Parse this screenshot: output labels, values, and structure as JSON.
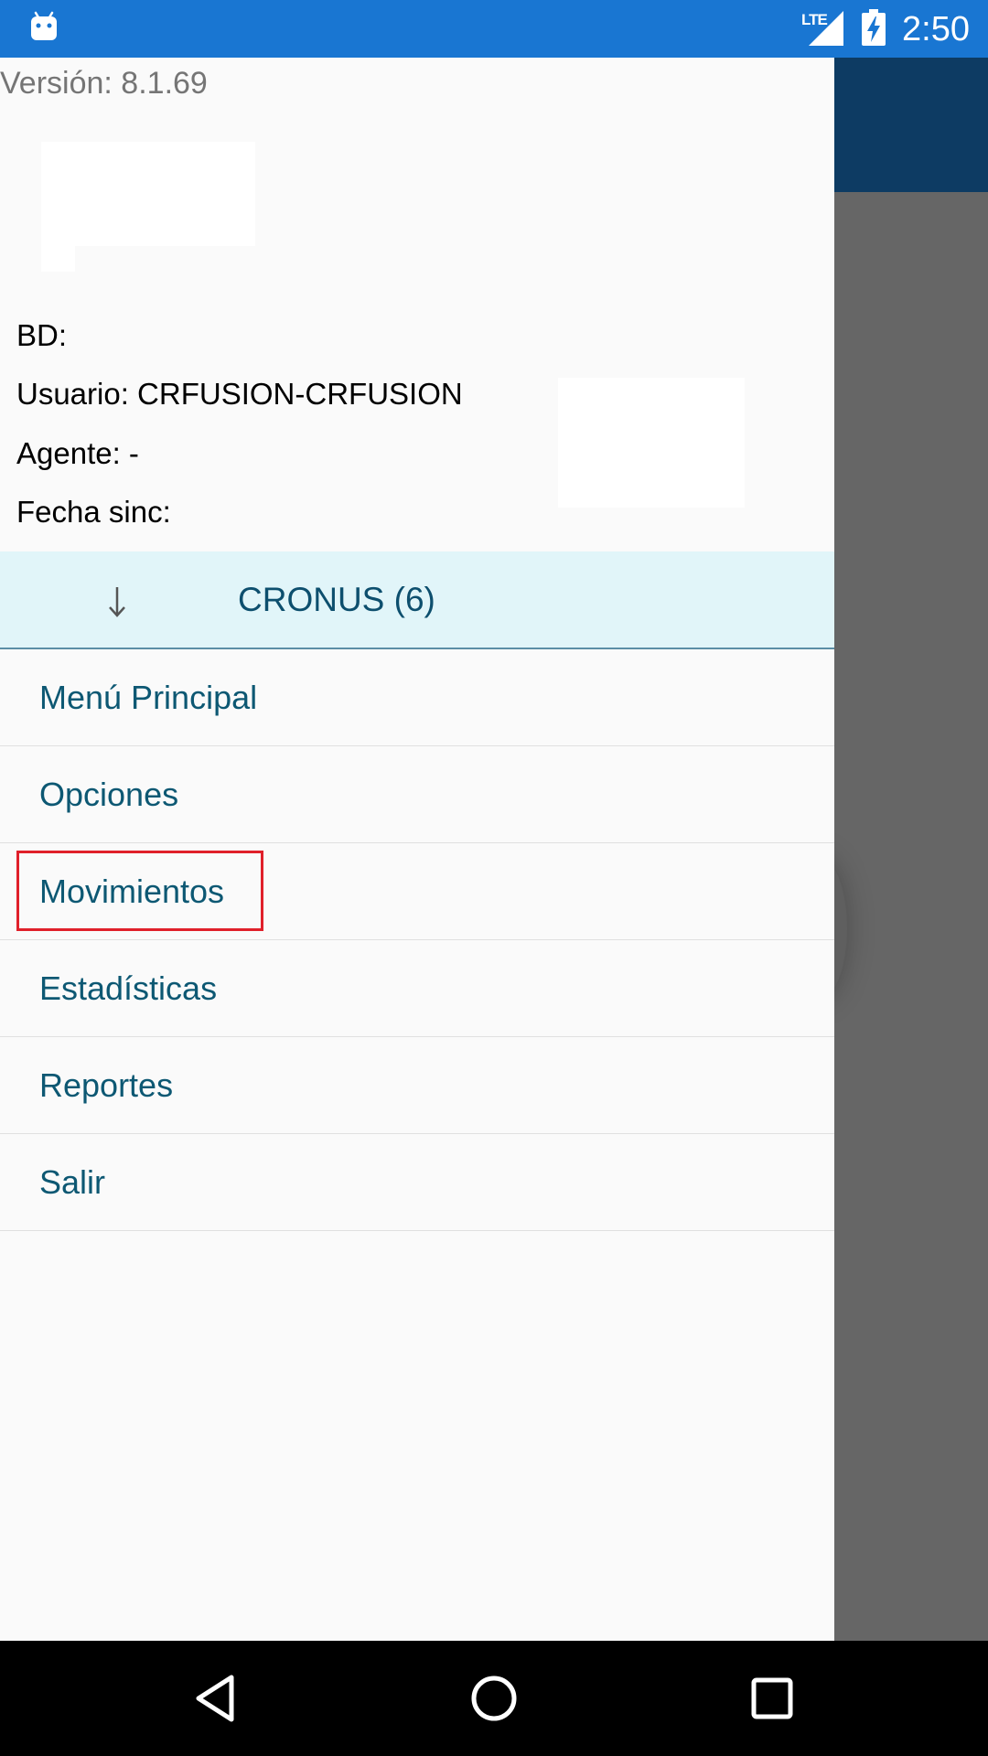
{
  "status_bar": {
    "network_label": "LTE",
    "time": "2:50",
    "background_color": "#1976d2"
  },
  "drawer": {
    "version": "Versión: 8.1.69",
    "info": {
      "bd": "BD:",
      "usuario": "Usuario: CRFUSION-CRFUSION",
      "agente": "Agente: -",
      "fecha_sinc": "Fecha sinc:"
    },
    "company": {
      "icon": "arrow-down-icon",
      "label": "CRONUS (6)"
    },
    "menu": [
      {
        "label": "Menú Principal"
      },
      {
        "label": "Opciones"
      },
      {
        "label": "Movimientos",
        "highlighted": true
      },
      {
        "label": "Estadísticas"
      },
      {
        "label": "Reportes"
      },
      {
        "label": "Salir"
      }
    ]
  },
  "nav_bar": {
    "icons": [
      "back-icon",
      "home-icon",
      "recent-apps-icon"
    ]
  },
  "colors": {
    "toolbar": "#0d3b63",
    "menu_text": "#0d5873",
    "company_row_bg": "#e1f5f9",
    "highlight_border": "#e0202a"
  }
}
